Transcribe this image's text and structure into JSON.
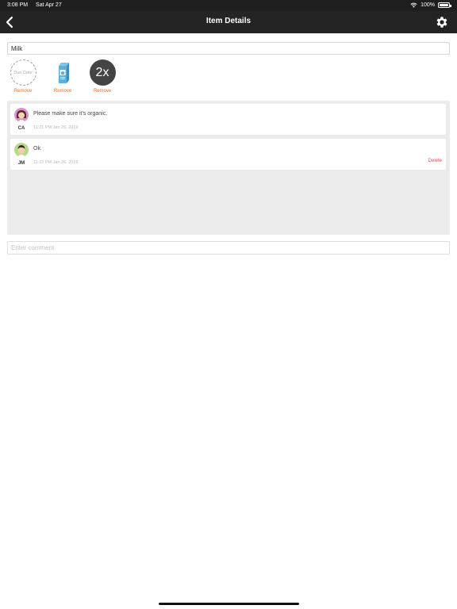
{
  "status_bar": {
    "time": "3:08 PM",
    "date": "Sat Apr 27",
    "battery": "100%",
    "wifi_icon": "wifi-icon",
    "battery_icon": "battery-icon"
  },
  "nav": {
    "title": "Item Details",
    "back_icon": "chevron-left-icon",
    "settings_icon": "gear-icon"
  },
  "item": {
    "name": "Milk"
  },
  "attributes": {
    "due_date": {
      "label": "Due Date",
      "remove_label": "Remove"
    },
    "image": {
      "icon": "milk-carton-icon",
      "remove_label": "Remove"
    },
    "quantity": {
      "value": "2x",
      "remove_label": "Remove"
    }
  },
  "comments": [
    {
      "initials": "CA",
      "text": "Please make sure it's organic.",
      "time": "11:21 PM Jan 26, 2019",
      "avatar": "avatar-female-icon"
    },
    {
      "initials": "JM",
      "text": "Ok.",
      "time": "11:22 PM Jan 26, 2019",
      "avatar": "avatar-male-icon",
      "delete_label": "Delete"
    }
  ],
  "comment_input": {
    "placeholder": "Enter comment",
    "value": ""
  },
  "colors": {
    "nav_background": "#242424",
    "accent_orange": "#f26c1f",
    "delete_red": "#e05252",
    "panel_gray": "#ebebeb"
  }
}
